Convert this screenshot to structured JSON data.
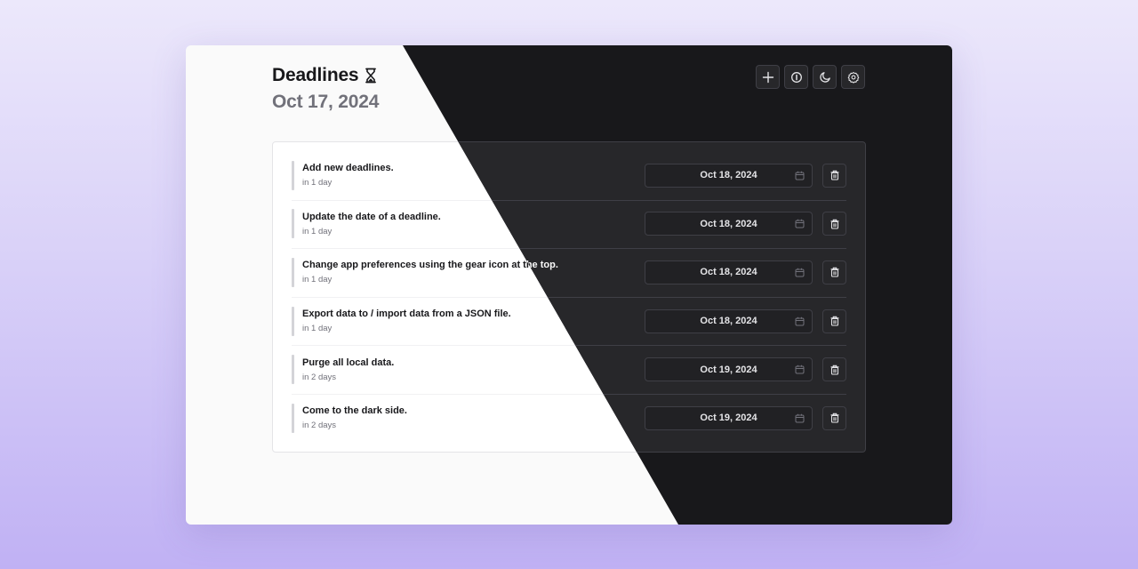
{
  "app": {
    "title": "Deadlines",
    "title_icon": "hourglass-icon",
    "current_date": "Oct 17, 2024"
  },
  "toolbar": {
    "buttons": [
      {
        "name": "add-deadline-button",
        "icon": "plus-icon",
        "label": "Add"
      },
      {
        "name": "info-button",
        "icon": "info-icon",
        "label": "Info"
      },
      {
        "name": "theme-toggle-button",
        "icon": "moon-icon",
        "label": "Dark mode"
      },
      {
        "name": "settings-button",
        "icon": "gear-icon",
        "label": "Settings"
      }
    ]
  },
  "deadlines": [
    {
      "title": "Add new deadlines.",
      "relative": "in 1 day",
      "date": "Oct 18, 2024"
    },
    {
      "title": "Update the date of a deadline.",
      "relative": "in 1 day",
      "date": "Oct 18, 2024"
    },
    {
      "title": "Change app preferences using the gear icon at the top.",
      "relative": "in 1 day",
      "date": "Oct 18, 2024"
    },
    {
      "title": "Export data to / import data from a JSON file.",
      "relative": "in 1 day",
      "date": "Oct 18, 2024"
    },
    {
      "title": "Purge all local data.",
      "relative": "in 2 days",
      "date": "Oct 19, 2024"
    },
    {
      "title": "Come to the dark side.",
      "relative": "in 2 days",
      "date": "Oct 19, 2024"
    }
  ],
  "colors": {
    "light_bg": "#fafafa",
    "dark_bg": "#18181b",
    "dark_card": "#27272a",
    "muted_text": "#71717a",
    "page_gradient_top": "#ece8fb",
    "page_gradient_bottom": "#c0b1f4"
  }
}
